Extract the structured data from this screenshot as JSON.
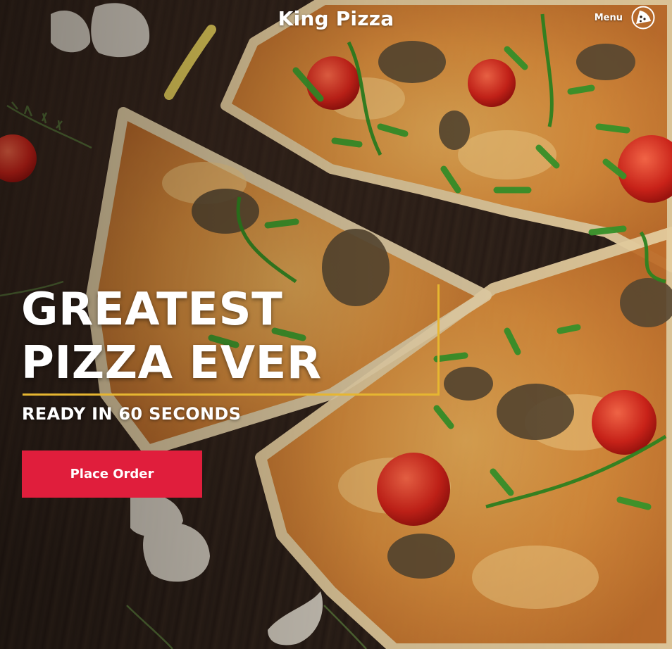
{
  "header": {
    "brand": "King Pizza",
    "menu_label": "Menu",
    "menu_icon": "pizza-slice-icon"
  },
  "hero": {
    "headline_line1": "GREATEST",
    "headline_line2": "PIZZA EVER",
    "subheadline": "READY IN 60 SECONDS",
    "cta_label": "Place Order",
    "background_image": "pizza-on-wooden-table-photo"
  },
  "colors": {
    "accent_yellow": "#e6b631",
    "cta_red": "#e01e3c",
    "text": "#ffffff"
  }
}
